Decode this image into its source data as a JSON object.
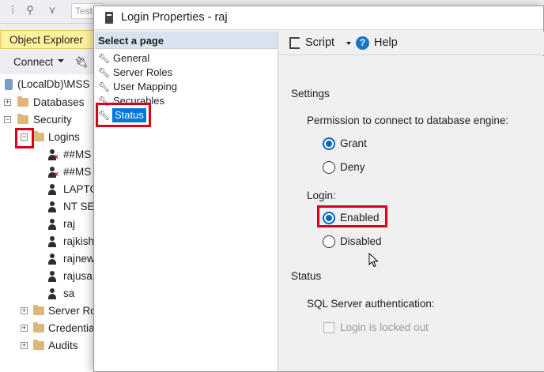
{
  "background": {
    "toolbar": {
      "search_box_text": "Test"
    },
    "object_explorer": {
      "title": "Object Explorer",
      "connect_label": "Connect",
      "tree": {
        "server": "(LocalDb)\\MSS",
        "databases": "Databases",
        "security": "Security",
        "logins": "Logins",
        "login_items": [
          "##MS",
          "##MS",
          "LAPTO",
          "NT SE",
          "raj",
          "rajkish",
          "rajnew",
          "rajusa",
          "sa"
        ],
        "server_roles": "Server Ro",
        "credentials": "Credentia",
        "audits": "Audits"
      }
    }
  },
  "dialog": {
    "title": "Login Properties - raj",
    "select_page_header": "Select a page",
    "pages": [
      "General",
      "Server Roles",
      "User Mapping",
      "Securables",
      "Status"
    ],
    "selected_page": "Status",
    "toolbar": {
      "script_label": "Script",
      "help_label": "Help"
    },
    "settings": {
      "section_label": "Settings",
      "permission_label": "Permission to connect to database engine:",
      "grant_label": "Grant",
      "deny_label": "Deny",
      "login_label": "Login:",
      "enabled_label": "Enabled",
      "disabled_label": "Disabled",
      "permission_selected": "Grant",
      "login_selected": "Enabled"
    },
    "status": {
      "section_label": "Status",
      "sql_auth_label": "SQL Server authentication:",
      "locked_out_label": "Login is locked out",
      "locked_out_checked": false
    }
  },
  "colors": {
    "highlight_box": "#d9001b",
    "selection_blue": "#0078d7",
    "radio_blue": "#0067c0",
    "oe_header_yellow": "#fff29d"
  }
}
